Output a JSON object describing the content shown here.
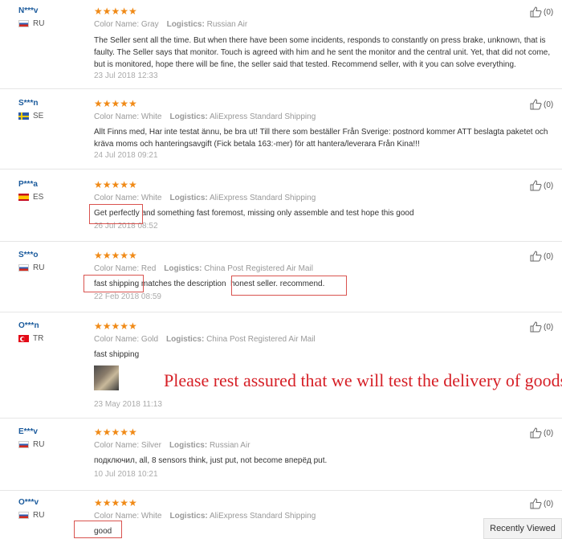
{
  "labels": {
    "color": "Color Name:",
    "logistics": "Logistics:"
  },
  "stars": "★★★★★",
  "reviews": [
    {
      "user": "N***v",
      "country": "RU",
      "flag": "ru",
      "color": "Gray",
      "logistics": "Russian Air",
      "text": "The Seller sent all the time. But when there have been some incidents, responds to constantly on press brake, unknown, that is faulty. The Seller says that monitor. Touch is agreed with him and he sent the monitor and the central unit. Yet, that did not come, but is monitored, hope there will be fine, the seller said that tested. Recommend seller, with it you can solve everything.",
      "date": "23 Jul 2018 12:33",
      "likes": "(0)"
    },
    {
      "user": "S***n",
      "country": "SE",
      "flag": "se",
      "color": "White",
      "logistics": "AliExpress Standard Shipping",
      "text": "Allt Finns med, Har inte testat ännu, be bra ut! Till there som beställer Från Sverige: postnord kommer ATT beslagta paketet och kräva moms och hanteringsavgift (Fick betala 163:-mer) för att hantera/leverara Från Kina!!!",
      "date": "24 Jul 2018 09:21",
      "likes": "(0)"
    },
    {
      "user": "P***a",
      "country": "ES",
      "flag": "es",
      "color": "White",
      "logistics": "AliExpress Standard Shipping",
      "text": "Get perfectly and something fast foremost, missing only assemble and test hope this good",
      "date": "26 Jul 2018 08:52",
      "likes": "(0)"
    },
    {
      "user": "S***o",
      "country": "RU",
      "flag": "ru",
      "color": "Red",
      "logistics": "China Post Registered Air Mail",
      "text": "fast shipping matches the description  honest seller. recommend.",
      "date": "22 Feb 2018 08:59",
      "likes": "(0)"
    },
    {
      "user": "O***n",
      "country": "TR",
      "flag": "tr",
      "color": "Gold",
      "logistics": "China Post Registered Air Mail",
      "text": "fast shipping",
      "date": "23 May 2018 11:13",
      "likes": "(0)"
    },
    {
      "user": "E***v",
      "country": "RU",
      "flag": "ru",
      "color": "Silver",
      "logistics": "Russian Air",
      "text": "подключил, all, 8 sensors think, just put, not become вперёд put.",
      "date": "10 Jul 2018 10:21",
      "likes": "(0)"
    },
    {
      "user": "O***v",
      "country": "RU",
      "flag": "ru",
      "color": "White",
      "logistics": "AliExpress Standard Shipping",
      "text": "good",
      "date": "",
      "likes": "(0)"
    }
  ],
  "promo_text": "Please rest assured that we will test the delivery of goods.",
  "recently_viewed": "Recently Viewed",
  "colors": {
    "star": "#f08a17",
    "username": "#1a5a9c",
    "promo": "#d61f26",
    "highlight_box": "#d9534f"
  }
}
